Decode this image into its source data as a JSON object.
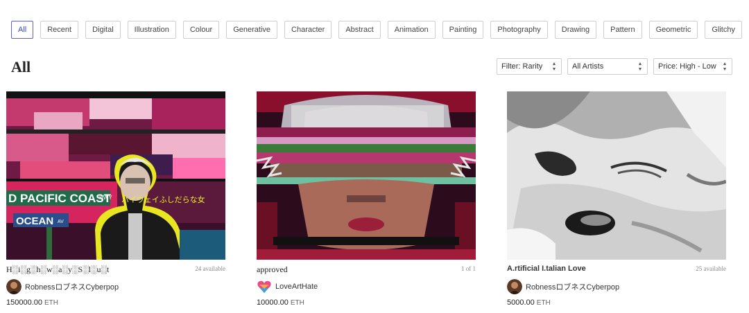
{
  "categories": [
    "All",
    "Recent",
    "Digital",
    "Illustration",
    "Colour",
    "Generative",
    "Character",
    "Abstract",
    "Animation",
    "Painting",
    "Photography",
    "Drawing",
    "Pattern",
    "Geometric",
    "Glitchy"
  ],
  "active_category": "All",
  "page_title": "All",
  "filters": {
    "rarity": "Filter: Rarity",
    "artists": "All Artists",
    "price": "Price: High - Low"
  },
  "cards": [
    {
      "title": "H░i░g░h░w░a░y░S░l░u░t",
      "availability": "24 available",
      "artist": "RobnessロブネスCyberpop",
      "price": "150000.00",
      "currency": "ETH",
      "art_text": {
        "street1": "D PACIFIC COAST",
        "street1_sub": "HWY",
        "street2": "OCEAN",
        "street2_sub": "AV",
        "jp": "ハイウェイふしだらな女"
      }
    },
    {
      "title": "approved",
      "availability": "1 of 1",
      "artist": "LoveArtHate",
      "price": "10000.00",
      "currency": "ETH"
    },
    {
      "title": "A.rtificial I.talian Love",
      "availability": "25 available",
      "artist": "RobnessロブネスCyberpop",
      "price": "5000.00",
      "currency": "ETH"
    }
  ],
  "colors": {
    "accent": "#3b40c7",
    "border": "#cfcfcf"
  },
  "icons": {
    "select_arrow": "sort-arrows-icon"
  }
}
